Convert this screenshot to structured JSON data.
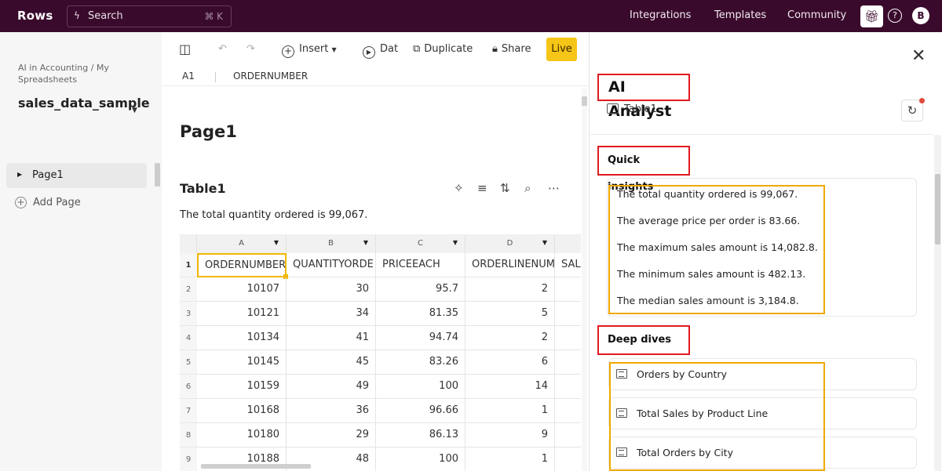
{
  "topbar": {
    "logo": "Rows",
    "search_label": "Search",
    "search_shortcut": "⌘ K",
    "nav": [
      "Integrations",
      "Templates",
      "Community"
    ],
    "avatar": "B"
  },
  "sidebar": {
    "breadcrumb": "AI in Accounting / My Spreadsheets",
    "sheet_name": "sales_data_sample",
    "pages": [
      {
        "label": "Page1"
      }
    ],
    "add_page": "Add Page"
  },
  "toolbar": {
    "insert": "Insert",
    "data": "Dat",
    "duplicate": "Duplicate",
    "share": "Share",
    "live": "Live"
  },
  "formula_bar": {
    "cell_ref": "A1",
    "value": "ORDERNUMBER"
  },
  "page": {
    "title": "Page1",
    "table_title": "Table1",
    "summary": "The total quantity ordered is 99,067."
  },
  "grid": {
    "column_letters": [
      "A",
      "B",
      "C",
      "D"
    ],
    "headers": [
      "ORDERNUMBER",
      "QUANTITYORDE",
      "PRICEEACH",
      "ORDERLINENUM",
      "SALI"
    ],
    "row_numbers": [
      "1",
      "2",
      "3",
      "4",
      "5",
      "6",
      "7",
      "8",
      "9"
    ],
    "rows": [
      [
        "10107",
        "30",
        "95.7",
        "2"
      ],
      [
        "10121",
        "34",
        "81.35",
        "5"
      ],
      [
        "10134",
        "41",
        "94.74",
        "2"
      ],
      [
        "10145",
        "45",
        "83.26",
        "6"
      ],
      [
        "10159",
        "49",
        "100",
        "14"
      ],
      [
        "10168",
        "36",
        "96.66",
        "1"
      ],
      [
        "10180",
        "29",
        "86.13",
        "9"
      ],
      [
        "10188",
        "48",
        "100",
        "1"
      ]
    ]
  },
  "panel": {
    "title": "AI Analyst",
    "table": "Table1",
    "quick_insights_title": "Quick insights",
    "insights": [
      "The total quantity ordered is 99,067.",
      "The average price per order is 83.66.",
      "The maximum sales amount is 14,082.8.",
      "The minimum sales amount is 482.13.",
      "The median sales amount is 3,184.8."
    ],
    "deep_dives_title": "Deep dives",
    "deep_dives": [
      "Orders by Country",
      "Total Sales by Product Line",
      "Total Orders by City"
    ]
  },
  "colors": {
    "topbar_bg": "#3a0a2c",
    "live_button": "#f5c518",
    "annotation_red": "#e01b22",
    "annotation_yellow": "#f0a800",
    "selected_cell_border": "#f2b705"
  }
}
